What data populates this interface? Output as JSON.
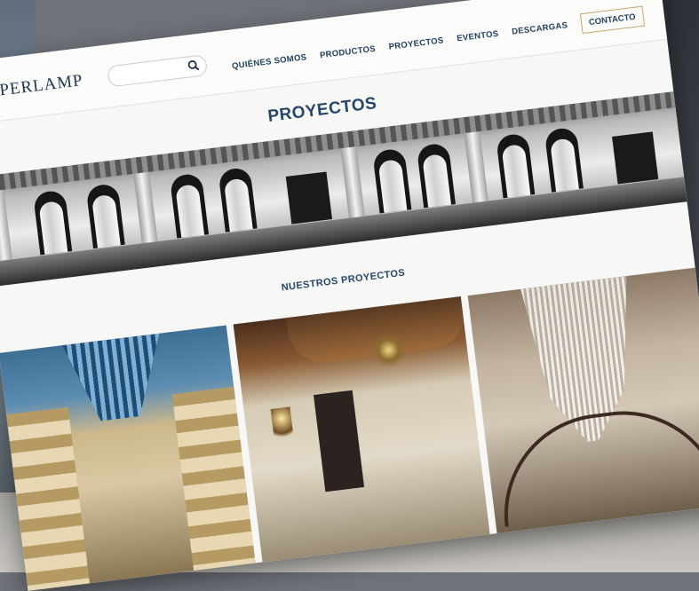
{
  "brand": {
    "logo_text": "RIPERLAMP"
  },
  "search": {
    "placeholder": "",
    "icon": "search-icon"
  },
  "nav": {
    "items": [
      "QUIÉNES SOMOS",
      "PRODUCTOS",
      "PROYECTOS",
      "EVENTOS",
      "DESCARGAS"
    ],
    "contact_label": "CONTACTO"
  },
  "page": {
    "title": "PROYECTOS",
    "section_title": "NUESTROS PROYECTOS"
  },
  "colors": {
    "accent_text": "#24476a",
    "contact_border": "#c8a86a"
  }
}
